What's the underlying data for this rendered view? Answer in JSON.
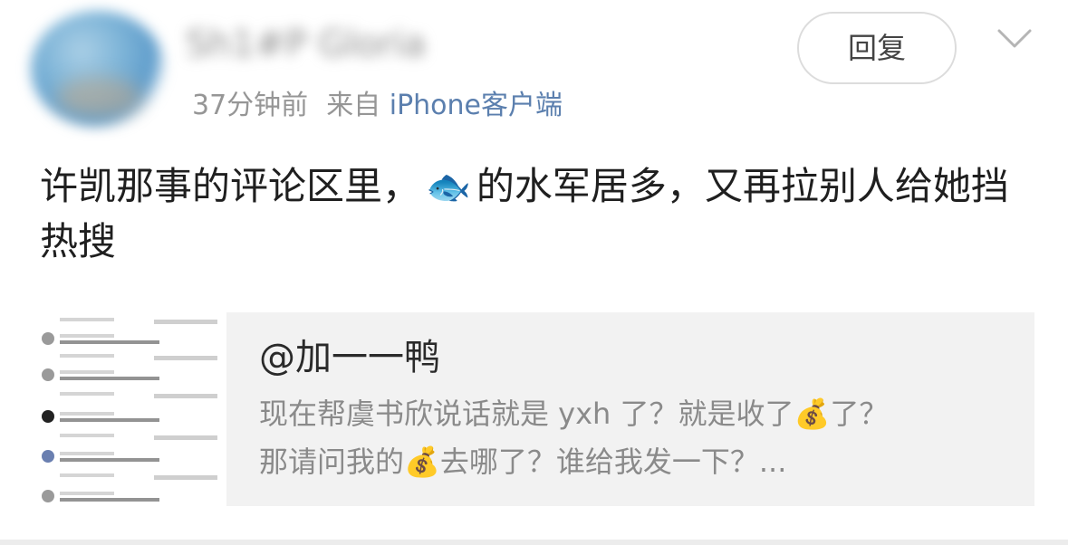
{
  "post": {
    "username": "Sh1#P Gloria",
    "time": "37分钟前",
    "source_prefix": "来自",
    "source": "iPhone客户端",
    "reply_label": "回复",
    "text_part1": "许凯那事的评论区里，",
    "emoji_fish": "🐟",
    "text_part2": "的水军居多，又再拉别人给她挡热搜"
  },
  "quote": {
    "user": "@加一一鸭",
    "text_part1": "现在帮虞书欣说话就是 yxh 了？就是收了",
    "emoji_money1": "💰",
    "text_part2": "了？",
    "text_part3": "那请问我的",
    "emoji_money2": "💰",
    "text_part4": "去哪了？谁给我发一下？..."
  },
  "icons": {
    "chevron": "chevron-down-icon",
    "avatar": "avatar"
  },
  "colors": {
    "source_link": "#5b7fae",
    "meta_gray": "#969696",
    "quote_bg": "#f2f2f2"
  }
}
